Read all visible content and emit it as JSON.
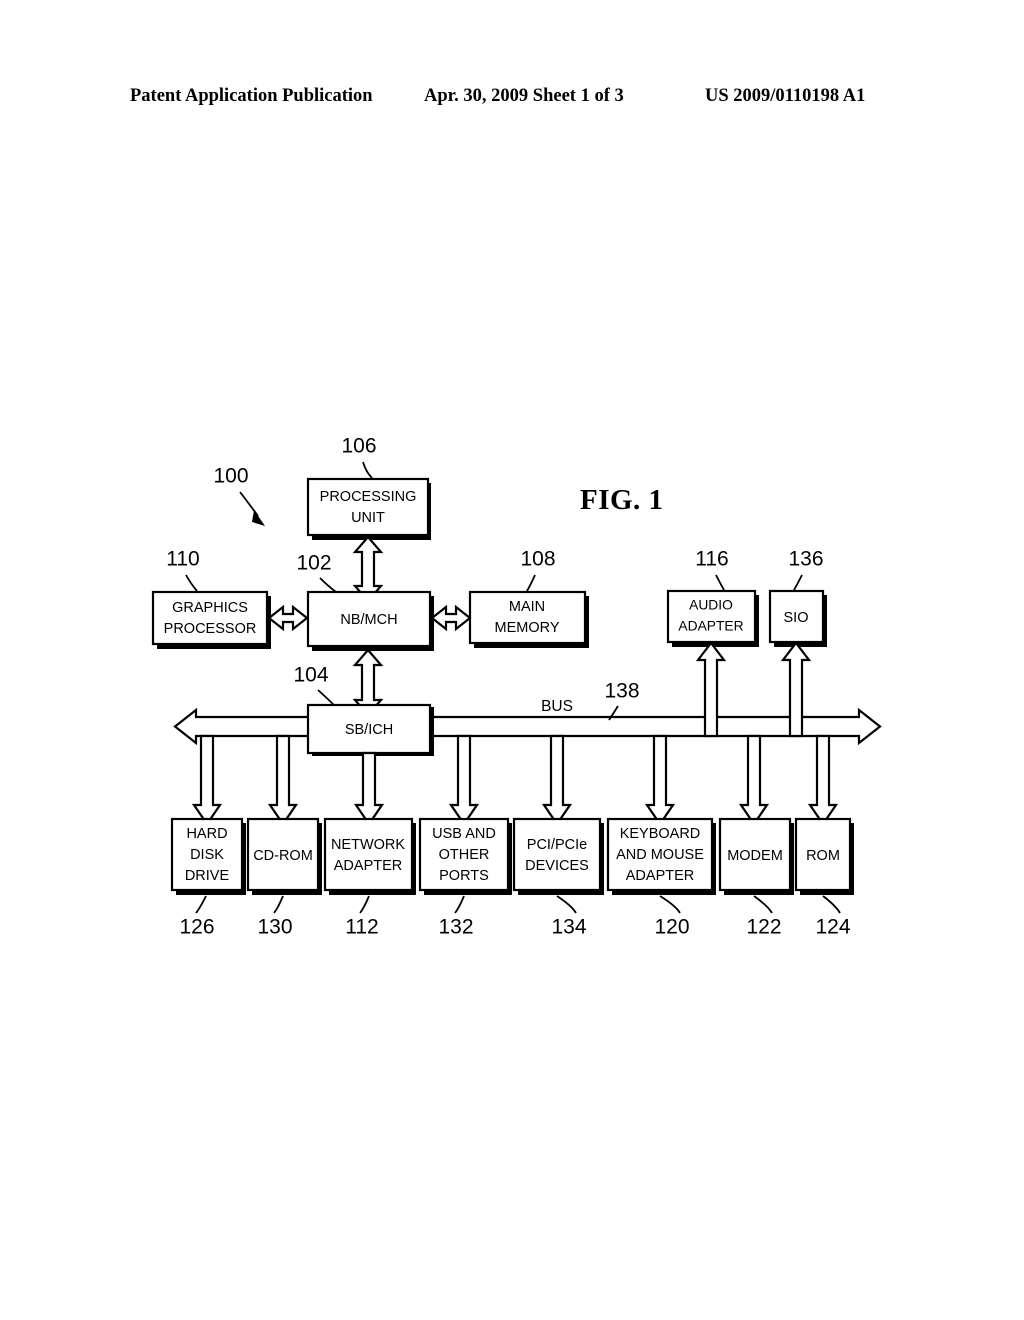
{
  "header": {
    "left": "Patent Application Publication",
    "middle": "Apr. 30, 2009  Sheet 1 of 3",
    "right": "US 2009/0110198 A1"
  },
  "figure": {
    "label": "FIG. 1",
    "system_ref": "100",
    "bus_label": "BUS",
    "bus_ref": "138",
    "blocks": [
      {
        "id": "processing-unit",
        "label_lines": [
          "PROCESSING",
          "UNIT"
        ],
        "ref": "106"
      },
      {
        "id": "graphics-processor",
        "label_lines": [
          "GRAPHICS",
          "PROCESSOR"
        ],
        "ref": "110"
      },
      {
        "id": "nb-mch",
        "label_lines": [
          "NB/MCH"
        ],
        "ref": "102"
      },
      {
        "id": "main-memory",
        "label_lines": [
          "MAIN",
          "MEMORY"
        ],
        "ref": "108"
      },
      {
        "id": "audio-adapter",
        "label_lines": [
          "AUDIO",
          "ADAPTER"
        ],
        "ref": "116"
      },
      {
        "id": "sio",
        "label_lines": [
          "SIO"
        ],
        "ref": "136"
      },
      {
        "id": "sb-ich",
        "label_lines": [
          "SB/ICH"
        ],
        "ref": "104"
      },
      {
        "id": "hard-disk-drive",
        "label_lines": [
          "HARD",
          "DISK",
          "DRIVE"
        ],
        "ref": "126"
      },
      {
        "id": "cd-rom",
        "label_lines": [
          "CD-ROM"
        ],
        "ref": "130"
      },
      {
        "id": "network-adapter",
        "label_lines": [
          "NETWORK",
          "ADAPTER"
        ],
        "ref": "112"
      },
      {
        "id": "usb-other-ports",
        "label_lines": [
          "USB AND",
          "OTHER",
          "PORTS"
        ],
        "ref": "132"
      },
      {
        "id": "pci-pcie-devices",
        "label_lines": [
          "PCI/PCIe",
          "DEVICES"
        ],
        "ref": "134"
      },
      {
        "id": "keyboard-mouse",
        "label_lines": [
          "KEYBOARD",
          "AND MOUSE",
          "ADAPTER"
        ],
        "ref": "120"
      },
      {
        "id": "modem",
        "label_lines": [
          "MODEM"
        ],
        "ref": "122"
      },
      {
        "id": "rom",
        "label_lines": [
          "ROM"
        ],
        "ref": "124"
      }
    ]
  },
  "colors": {
    "ink": "#000000",
    "paper": "#ffffff"
  }
}
